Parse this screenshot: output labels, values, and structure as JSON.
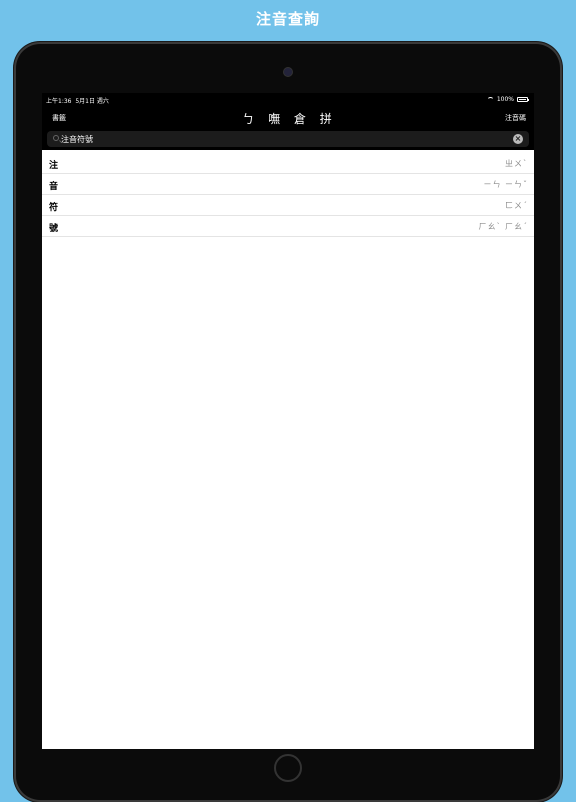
{
  "banner": {
    "title": "注音查詢"
  },
  "status_bar": {
    "time": "上午1:36",
    "date": "5月1日 週六",
    "battery": "100%",
    "battery_level": 1.0
  },
  "navbar": {
    "left_label": "書籤",
    "center_tabs": [
      "ㄅ",
      "嘸",
      "倉",
      "拼"
    ],
    "right_label": "注音碼"
  },
  "search": {
    "value": "注音符號",
    "placeholder": ""
  },
  "results": [
    {
      "char": "注",
      "zhuyin": "ㄓㄨˋ"
    },
    {
      "char": "音",
      "zhuyin": "ㄧㄣ ㄧㄣˇ"
    },
    {
      "char": "符",
      "zhuyin": "ㄈㄨˊ"
    },
    {
      "char": "號",
      "zhuyin": "ㄏㄠˋ ㄏㄠˊ"
    }
  ],
  "colors": {
    "background": "#72c2ea",
    "device": "#0b0b0b",
    "bar": "#000000"
  }
}
